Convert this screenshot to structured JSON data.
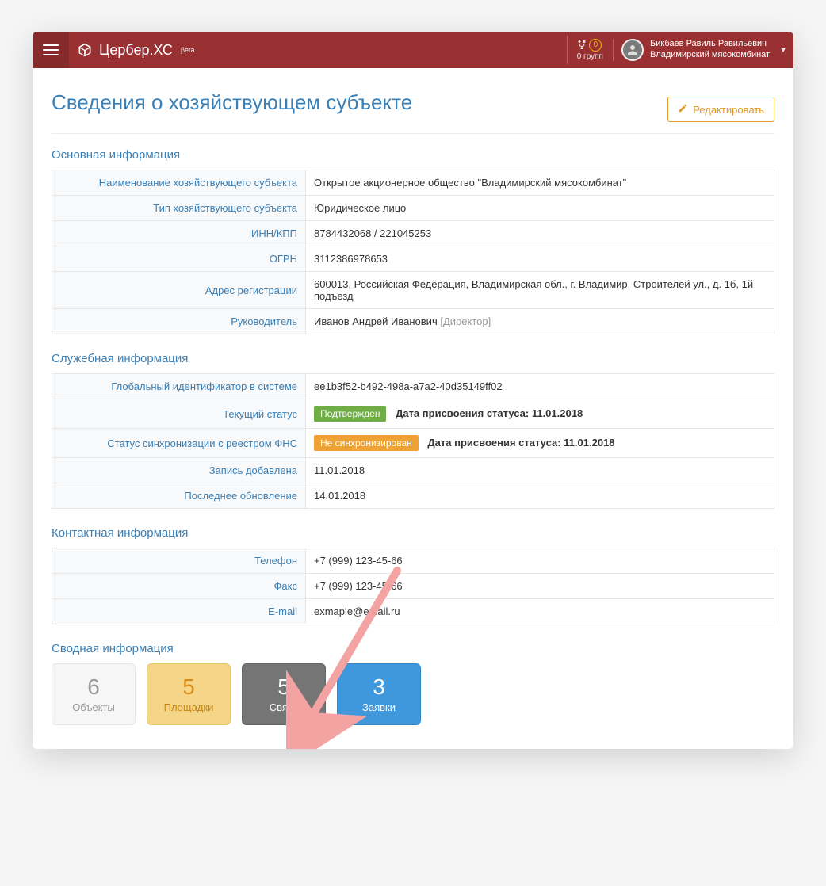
{
  "header": {
    "brand": "Цербер.ХС",
    "brand_suffix": "βeta",
    "groups_count": "0",
    "groups_label": "0 групп",
    "user_name": "Бикбаев Равиль Равильевич",
    "user_org": "Владимирский мясокомбинат"
  },
  "page": {
    "title": "Сведения о хозяйствующем субъекте",
    "edit_label": "Редактировать"
  },
  "sections": {
    "basic": "Основная информация",
    "service": "Служебная информация",
    "contact": "Контактная информация",
    "summary": "Сводная информация"
  },
  "basic": {
    "k_name": "Наименование хозяйствующего субъекта",
    "v_name": "Открытое акционерное общество \"Владимирский мясокомбинат\"",
    "k_type": "Тип хозяйствующего субъекта",
    "v_type": "Юридическое лицо",
    "k_inn": "ИНН/КПП",
    "v_inn": "8784432068 / 221045253",
    "k_ogrn": "ОГРН",
    "v_ogrn": "3112386978653",
    "k_addr": "Адрес регистрации",
    "v_addr": "600013, Российская Федерация, Владимирская обл., г. Владимир, Строителей ул., д. 1б, 1й подъезд",
    "k_head": "Руководитель",
    "v_head": "Иванов Андрей Иванович",
    "v_head_role": "[Директор]"
  },
  "service": {
    "k_guid": "Глобальный идентификатор в системе",
    "v_guid": "ee1b3f52-b492-498a-a7a2-40d35149ff02",
    "k_status": "Текущий статус",
    "v_status_badge": "Подтвержден",
    "v_status_date_label": "Дата присвоения статуса:",
    "v_status_date": "11.01.2018",
    "k_sync": "Статус синхронизации с реестром ФНС",
    "v_sync_badge": "Не синхронизирован",
    "v_sync_date_label": "Дата присвоения статуса:",
    "v_sync_date": "11.01.2018",
    "k_added": "Запись добавлена",
    "v_added": "11.01.2018",
    "k_updated": "Последнее обновление",
    "v_updated": "14.01.2018"
  },
  "contact": {
    "k_phone": "Телефон",
    "v_phone": "+7 (999) 123-45-66",
    "k_fax": "Факс",
    "v_fax": "+7 (999) 123-45-66",
    "k_email": "E-mail",
    "v_email": "exmaple@email.ru"
  },
  "tiles": [
    {
      "num": "6",
      "label": "Объекты"
    },
    {
      "num": "5",
      "label": "Площадки"
    },
    {
      "num": "5",
      "label": "Связи"
    },
    {
      "num": "3",
      "label": "Заявки"
    }
  ]
}
